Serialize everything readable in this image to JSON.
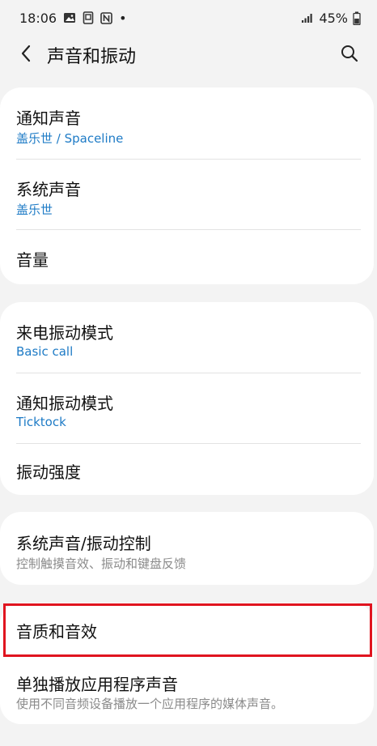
{
  "status_bar": {
    "time": "18:06",
    "dot": "•",
    "battery_percent": "45%",
    "icons": [
      "gallery-icon",
      "screenshot-icon",
      "nfc-icon",
      "signal-icon",
      "battery-icon"
    ]
  },
  "header": {
    "title": "声音和振动",
    "back_icon": "chevron-left-icon",
    "search_icon": "search-icon"
  },
  "cards": [
    {
      "items": [
        {
          "title": "通知声音",
          "subtitle": "盖乐世 / Spaceline"
        },
        {
          "title": "系统声音",
          "subtitle": "盖乐世"
        },
        {
          "title": "音量"
        }
      ]
    },
    {
      "items": [
        {
          "title": "来电振动模式",
          "subtitle": "Basic call"
        },
        {
          "title": "通知振动模式",
          "subtitle": "Ticktock"
        },
        {
          "title": "振动强度"
        }
      ]
    },
    {
      "items": [
        {
          "title": "系统声音/振动控制",
          "subtitle": "控制触摸音效、振动和键盘反馈"
        }
      ]
    },
    {
      "items": [
        {
          "title": "音质和音效",
          "highlighted": true
        },
        {
          "title": "单独播放应用程序声音",
          "subtitle": "使用不同音频设备播放一个应用程序的媒体声音。"
        }
      ]
    }
  ],
  "colors": {
    "background": "#f3f3f3",
    "card": "#ffffff",
    "accent_subtitle": "#1e7bc6",
    "gray_subtitle": "#8a8a8a",
    "highlight_border": "#e0141f"
  }
}
